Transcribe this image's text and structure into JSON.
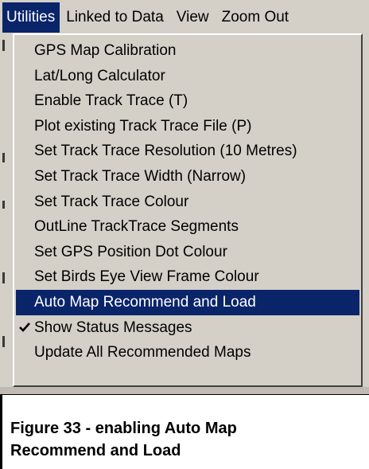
{
  "menubar": {
    "items": [
      {
        "label": "Utilities",
        "active": true
      },
      {
        "label": "Linked to Data",
        "active": false
      },
      {
        "label": "View",
        "active": false
      },
      {
        "label": "Zoom Out",
        "active": false
      }
    ]
  },
  "dropdown": {
    "items": [
      {
        "label": "GPS Map Calibration",
        "checked": false,
        "highlighted": false
      },
      {
        "label": "Lat/Long Calculator",
        "checked": false,
        "highlighted": false
      },
      {
        "label": "Enable Track Trace (T)",
        "checked": false,
        "highlighted": false
      },
      {
        "label": "Plot existing Track Trace File (P)",
        "checked": false,
        "highlighted": false
      },
      {
        "label": "Set Track Trace Resolution  (10 Metres)",
        "checked": false,
        "highlighted": false
      },
      {
        "label": "Set Track Trace Width   (Narrow)",
        "checked": false,
        "highlighted": false
      },
      {
        "label": "Set Track Trace  Colour",
        "checked": false,
        "highlighted": false
      },
      {
        "label": "OutLine TrackTrace Segments",
        "checked": false,
        "highlighted": false
      },
      {
        "label": "Set GPS Position Dot Colour",
        "checked": false,
        "highlighted": false
      },
      {
        "label": "Set Birds Eye View Frame Colour",
        "checked": false,
        "highlighted": false
      },
      {
        "label": "Auto Map Recommend and Load",
        "checked": false,
        "highlighted": true
      },
      {
        "label": "Show Status Messages",
        "checked": true,
        "highlighted": false
      },
      {
        "label": "Update All Recommended Maps",
        "checked": false,
        "highlighted": false
      }
    ]
  },
  "caption": {
    "text": "Figure 33 - enabling Auto Map Recommend and Load"
  },
  "colors": {
    "menu_face": "#d4d0c8",
    "highlight": "#0a246a",
    "highlight_text": "#ffffff"
  }
}
